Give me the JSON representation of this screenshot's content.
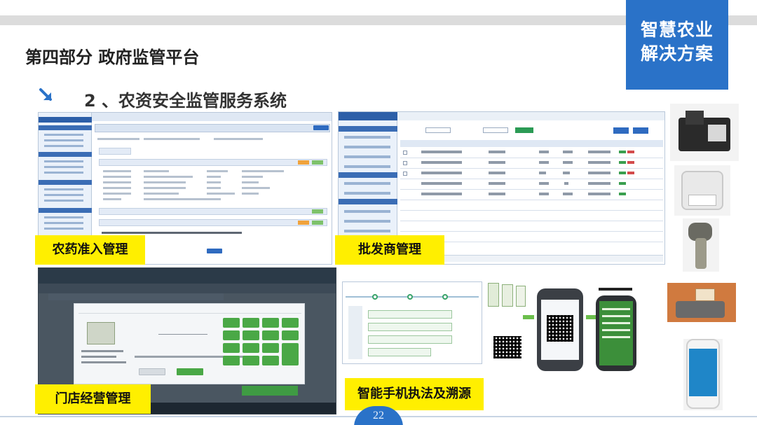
{
  "header": {
    "part_title": "第四部分  政府监管平台",
    "brand": "智慧农业\n解决方案"
  },
  "section": {
    "title": "2 、农资安全监管服务系统"
  },
  "panels": {
    "pesticide": {
      "caption": "农药准入管理"
    },
    "wholesale": {
      "caption": "批发商管理"
    },
    "store": {
      "caption": "门店经营管理"
    },
    "mobile": {
      "caption": "智能手机执法及溯源"
    }
  },
  "footer": {
    "page_number": "22"
  },
  "colors": {
    "brand_blue": "#2a72c8",
    "caption_yellow": "#ffef00",
    "title_text": "#222222"
  },
  "icons": {
    "section_marker": "arrow-down-right-icon"
  }
}
